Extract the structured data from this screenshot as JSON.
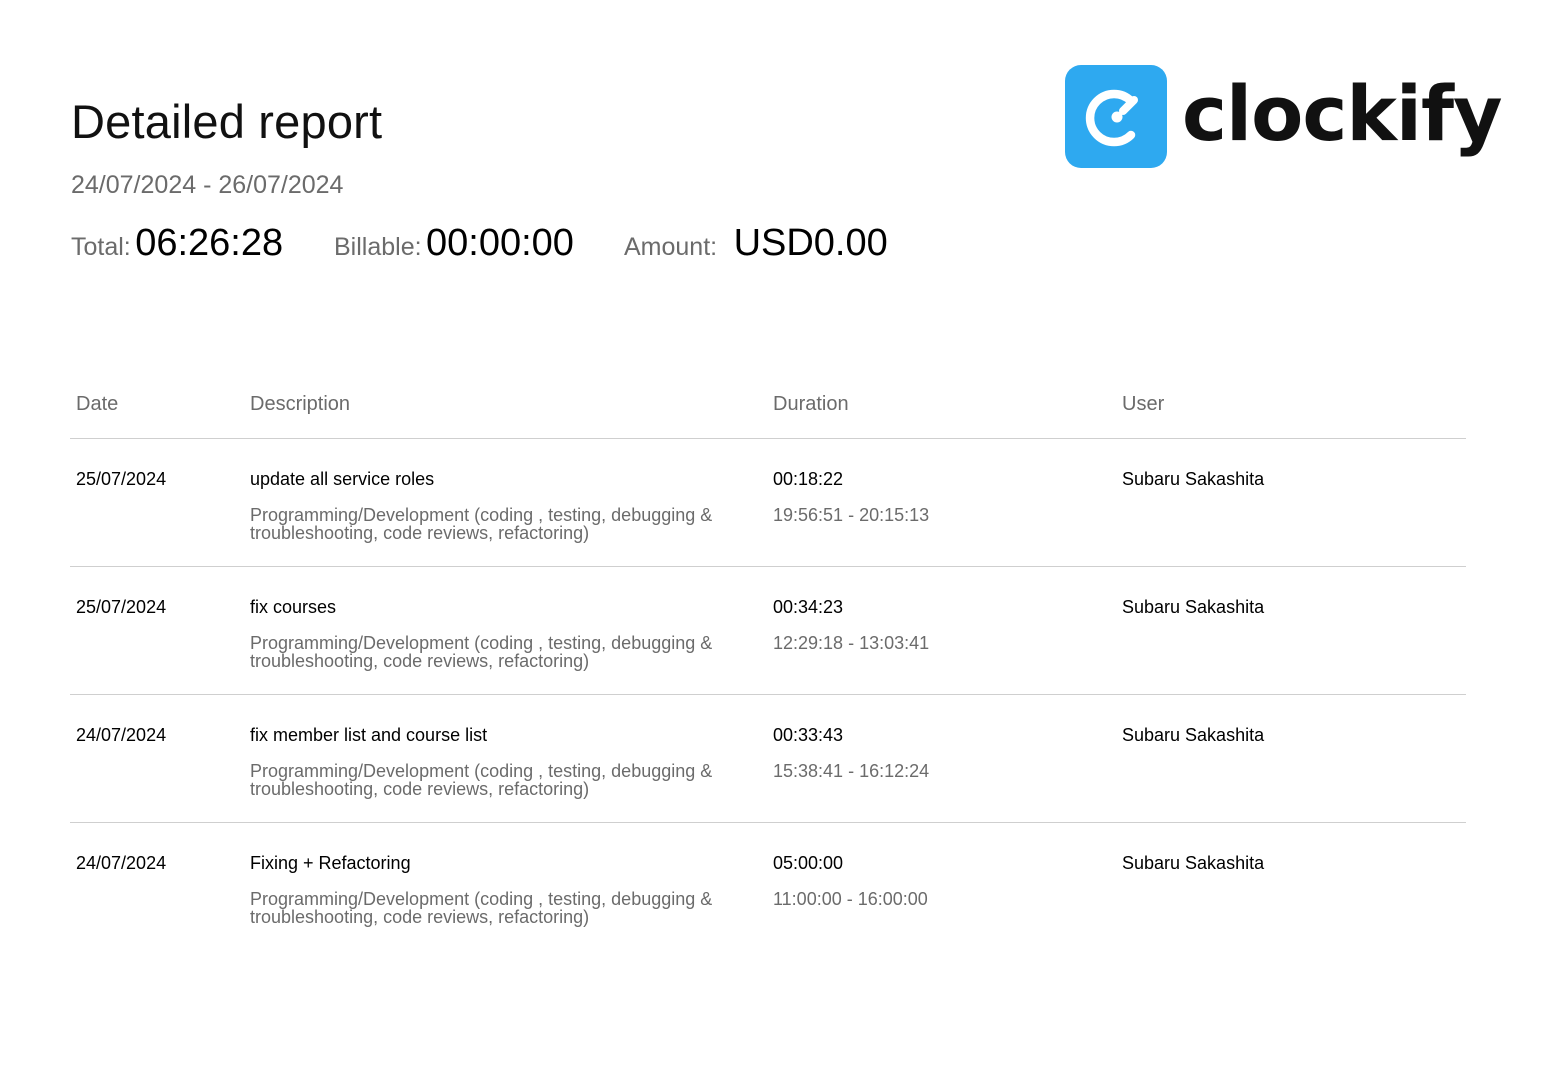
{
  "report": {
    "title": "Detailed report",
    "date_range": "24/07/2024 - 26/07/2024"
  },
  "summary": {
    "total_label": "Total:",
    "total_value": "06:26:28",
    "billable_label": "Billable:",
    "billable_value": "00:00:00",
    "amount_label": "Amount:",
    "amount_value": "USD0.00"
  },
  "logo": {
    "name": "clockify",
    "icon": "clockify-logo-icon",
    "brand_color": "#2ea9f0"
  },
  "table": {
    "headers": {
      "date": "Date",
      "description": "Description",
      "duration": "Duration",
      "user": "User"
    },
    "rows": [
      {
        "date": "25/07/2024",
        "description": "update all service roles",
        "project": "Programming/Development (coding , testing, debugging & troubleshooting, code reviews, refactoring)",
        "duration": "00:18:22",
        "time_range": "19:56:51 - 20:15:13",
        "user": "Subaru Sakashita"
      },
      {
        "date": "25/07/2024",
        "description": "fix courses",
        "project": "Programming/Development (coding , testing, debugging & troubleshooting, code reviews, refactoring)",
        "duration": "00:34:23",
        "time_range": "12:29:18 - 13:03:41",
        "user": "Subaru Sakashita"
      },
      {
        "date": "24/07/2024",
        "description": "fix member list and course list",
        "project": "Programming/Development (coding , testing, debugging & troubleshooting, code reviews, refactoring)",
        "duration": "00:33:43",
        "time_range": "15:38:41 - 16:12:24",
        "user": "Subaru Sakashita"
      },
      {
        "date": "24/07/2024",
        "description": "Fixing + Refactoring",
        "project": "Programming/Development (coding , testing, debugging & troubleshooting, code reviews, refactoring)",
        "duration": "05:00:00",
        "time_range": "11:00:00 - 16:00:00",
        "user": "Subaru Sakashita"
      }
    ]
  }
}
